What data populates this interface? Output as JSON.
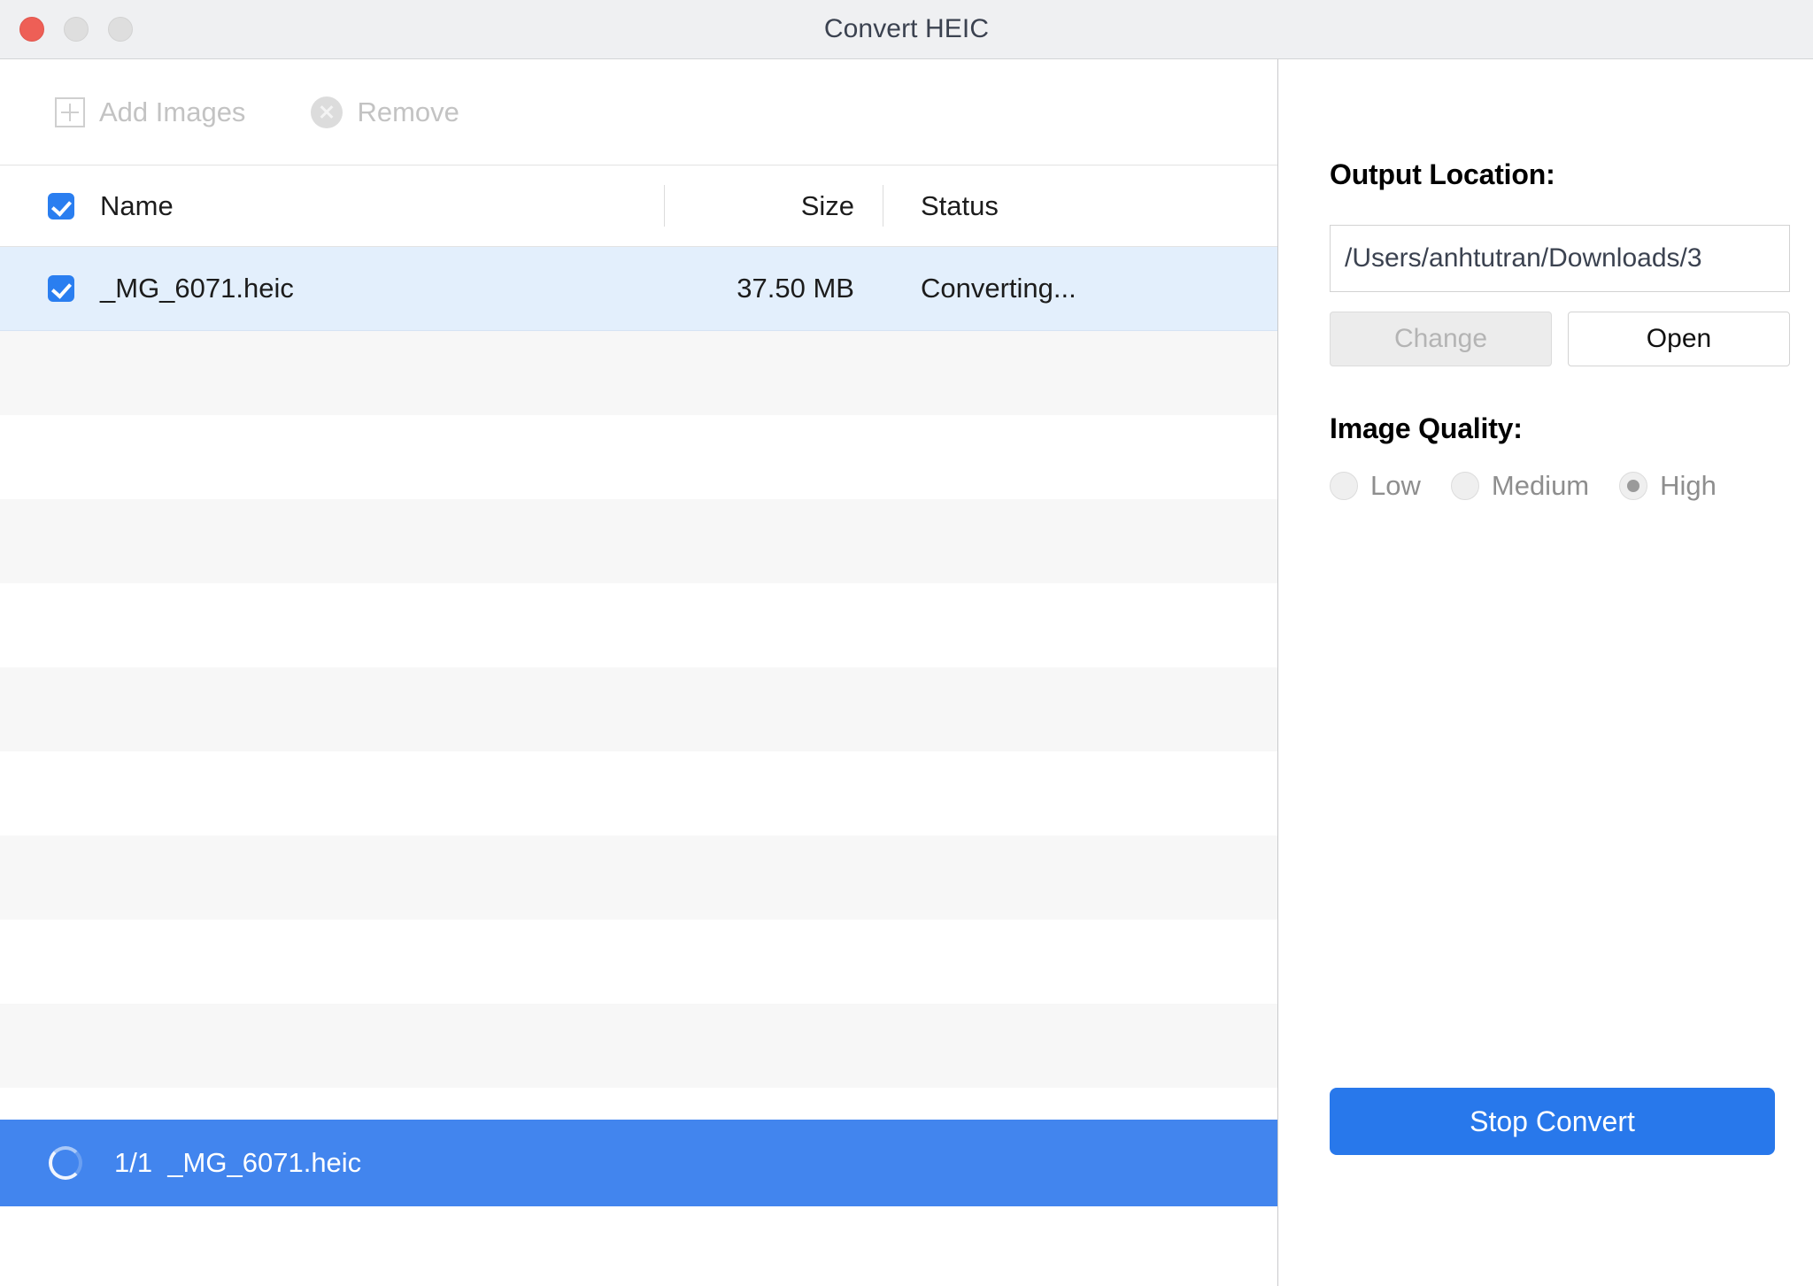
{
  "window": {
    "title": "Convert HEIC",
    "traffic_lights": [
      "close-button",
      "minimize-button",
      "maximize-button"
    ]
  },
  "toolbar": {
    "add_images_label": "Add Images",
    "add_images_icon": "plus-square-icon",
    "remove_label": "Remove",
    "remove_icon": "x-circle-icon"
  },
  "file_list": {
    "select_all_checked": true,
    "columns": [
      "Name",
      "Size",
      "Status"
    ],
    "rows": [
      {
        "checked": true,
        "name": "_MG_6071.heic",
        "size": "37.50 MB",
        "status": "Converting..."
      }
    ],
    "empty_row_count": 10
  },
  "progress": {
    "spinner_icon": "loading-spinner-icon",
    "text": "1/1  _MG_6071.heic"
  },
  "panel": {
    "output_location_label": "Output Location:",
    "output_path": "/Users/anhtutran/Downloads/3",
    "change_label": "Change",
    "change_enabled": false,
    "open_label": "Open",
    "open_enabled": true,
    "image_quality_label": "Image Quality:",
    "quality_options": [
      {
        "label": "Low",
        "selected": false
      },
      {
        "label": "Medium",
        "selected": false
      },
      {
        "label": "High",
        "selected": true
      }
    ],
    "action_label": "Stop Convert"
  },
  "colors": {
    "accent_blue": "#2878eb",
    "progress_blue": "#4285ee",
    "checkbox_blue": "#2a7ef0",
    "selected_row": "#e3effc",
    "titlebar": "#eff0f2",
    "close_red": "#ee5f56"
  }
}
